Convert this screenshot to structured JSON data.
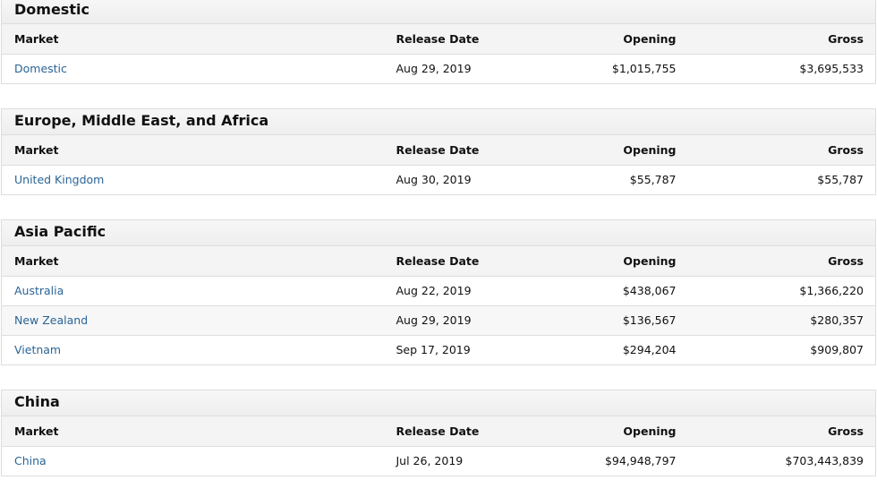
{
  "columns": {
    "market": "Market",
    "release_date": "Release Date",
    "opening": "Opening",
    "gross": "Gross"
  },
  "regions": [
    {
      "title": "Domestic",
      "rows": [
        {
          "market": "Domestic",
          "release_date": "Aug 29, 2019",
          "opening": "$1,015,755",
          "gross": "$3,695,533"
        }
      ]
    },
    {
      "title": "Europe, Middle East, and Africa",
      "rows": [
        {
          "market": "United Kingdom",
          "release_date": "Aug 30, 2019",
          "opening": "$55,787",
          "gross": "$55,787"
        }
      ]
    },
    {
      "title": "Asia Pacific",
      "rows": [
        {
          "market": "Australia",
          "release_date": "Aug 22, 2019",
          "opening": "$438,067",
          "gross": "$1,366,220"
        },
        {
          "market": "New Zealand",
          "release_date": "Aug 29, 2019",
          "opening": "$136,567",
          "gross": "$280,357"
        },
        {
          "market": "Vietnam",
          "release_date": "Sep 17, 2019",
          "opening": "$294,204",
          "gross": "$909,807"
        }
      ]
    },
    {
      "title": "China",
      "rows": [
        {
          "market": "China",
          "release_date": "Jul 26, 2019",
          "opening": "$94,948,797",
          "gross": "$703,443,839"
        }
      ]
    }
  ]
}
